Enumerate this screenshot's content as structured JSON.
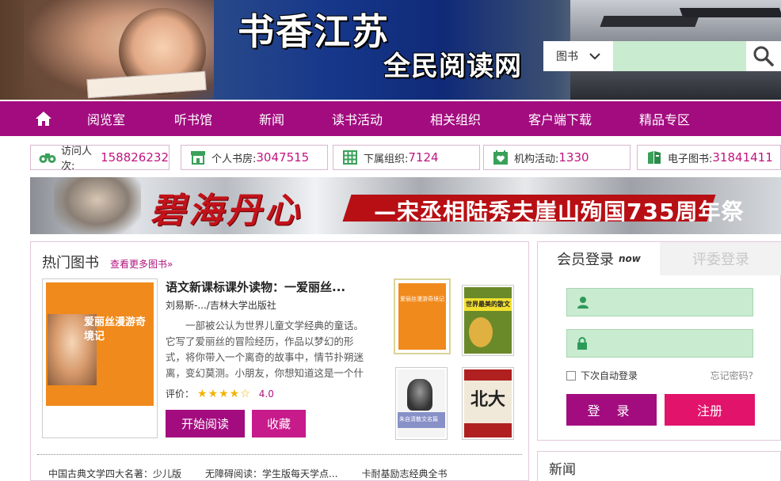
{
  "header": {
    "title": "书香江苏",
    "subtitle": "全民阅读网",
    "search": {
      "category": "图书",
      "placeholder": ""
    }
  },
  "nav": {
    "items": [
      "阅览室",
      "听书馆",
      "新闻",
      "读书活动",
      "相关组织",
      "客户端下载",
      "精品专区"
    ]
  },
  "stats": [
    {
      "label": "访问人次:",
      "value": "158826232",
      "icon": "binoculars-icon"
    },
    {
      "label": "个人书房:",
      "value": "3047515",
      "icon": "store-icon"
    },
    {
      "label": "下属组织:",
      "value": "7124",
      "icon": "grid-icon"
    },
    {
      "label": "机构活动:",
      "value": "1330",
      "icon": "calendar-heart-icon"
    },
    {
      "label": "电子图书:",
      "value": "31841411",
      "icon": "ebook-icon"
    }
  ],
  "banner": {
    "title": "碧海丹心",
    "subtitle": "—宋丞相陆秀夫崖山殉国735周年祭"
  },
  "hot_books": {
    "heading": "热门图书",
    "more": "查看更多图书»",
    "featured": {
      "title": "语文新课标课外读物：一爱丽丝...",
      "author": "刘易斯-.../吉林大学出版社",
      "description": "一部被公认为世界儿童文学经典的童话。它写了爱丽丝的冒险经历，作品以梦幻的形式，将你带入一个离奇的故事中，情节扑朔迷离，变幻莫测。小朋友，你想知道这是一个什么样的世界",
      "rating_label": "评价：",
      "rating_stars": "★★★★☆",
      "rating_value": "4.0",
      "rating_fraction": 0.8,
      "cover_text": "爱丽丝漫游奇境记",
      "read_button": "开始阅读",
      "fav_button": "收藏"
    },
    "thumb_titles": [
      "爱丽丝漫游奇境记",
      "世界最美的散文",
      "朱自清散文名篇",
      "北大"
    ],
    "links": [
      "中国古典文学四大名著：少儿版",
      "无障碍阅读：学生版每天学点...",
      "卡耐基励志经典全书"
    ]
  },
  "login": {
    "tab_member": "会员登录",
    "tab_member_badge": "now",
    "tab_judge": "评委登录",
    "username_placeholder": "",
    "password_placeholder": "",
    "remember_label": "下次自动登录",
    "forgot_label": "忘记密码?",
    "login_button": "登 录",
    "register_button": "注册"
  },
  "news": {
    "heading": "新闻"
  },
  "colors": {
    "brand": "#a30c7f",
    "accent": "#e2136b",
    "input": "#c9ebd0",
    "stat_value": "#c0147f"
  }
}
